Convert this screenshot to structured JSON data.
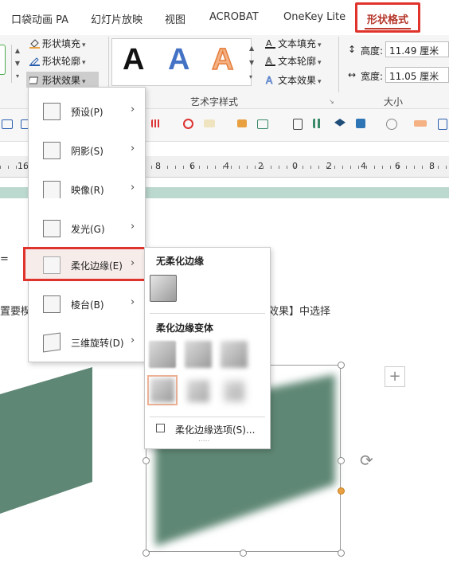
{
  "tabs": {
    "items": [
      "口袋动画 PA",
      "幻灯片放映",
      "视图",
      "ACROBAT",
      "OneKey Lite",
      "形状格式"
    ],
    "active": "形状格式"
  },
  "ribbon": {
    "shape_fill": "形状填充",
    "shape_outline": "形状轮廓",
    "shape_effect": "形状效果",
    "art_letters": [
      "A",
      "A",
      "A"
    ],
    "text_fill": "文本填充",
    "text_outline": "文本轮廓",
    "text_effect": "文本效果",
    "wordart_group": "艺术字样式",
    "height_label": "高度:",
    "height_value": "11.49 厘米",
    "width_label": "宽度:",
    "width_value": "11.05 厘米",
    "size_group": "大小"
  },
  "ruler": {
    "ticks": [
      "16",
      "8",
      "6",
      "4",
      "2",
      "0",
      "2",
      "4",
      "6",
      "8"
    ]
  },
  "slide": {
    "text_left": "置要楔",
    "text_right": "效果】中选择",
    "text_edge": "="
  },
  "effects_menu": {
    "items": [
      {
        "label": "预设(P)"
      },
      {
        "label": "阴影(S)"
      },
      {
        "label": "映像(R)"
      },
      {
        "label": "发光(G)"
      },
      {
        "label": "柔化边缘(E)"
      },
      {
        "label": "棱台(B)"
      },
      {
        "label": "三维旋转(D)"
      }
    ],
    "highlighted": "柔化边缘(E)"
  },
  "soft_edges_menu": {
    "no_soft_edges": "无柔化边缘",
    "variants": "柔化边缘变体",
    "options": "柔化边缘选项(S)...",
    "dots": "....."
  },
  "colors": {
    "accent_red": "#e0332b",
    "shape_green": "#5f8775",
    "band_green": "#bcd9cf"
  }
}
